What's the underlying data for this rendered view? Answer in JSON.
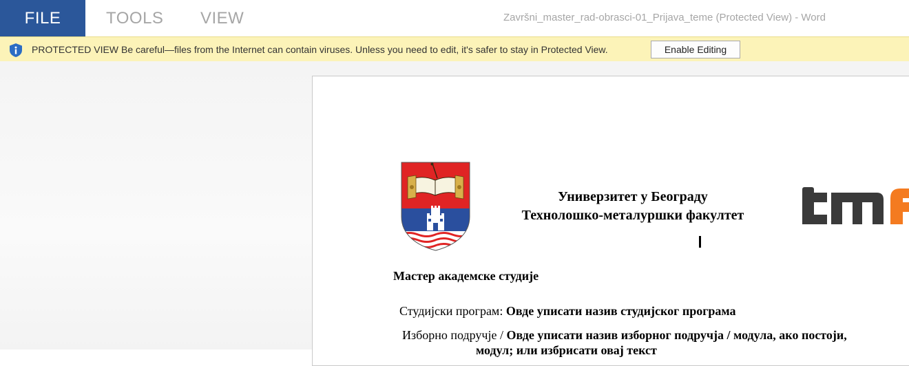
{
  "ribbon": {
    "tabs": [
      "FILE",
      "TOOLS",
      "VIEW"
    ],
    "window_title": "Završni_master_rad-obrasci-01_Prijava_teme (Protected View) - Word"
  },
  "protected_view": {
    "label": "PROTECTED VIEW",
    "message": "Be careful—files from the Internet can contain viruses. Unless you need to edit, it's safer to stay in Protected View.",
    "button": "Enable Editing",
    "icon": "shield-info-icon"
  },
  "document": {
    "university_line": "Универзитет у Београду",
    "faculty_line": "Технолошко-металуршки факултет",
    "study_type": "Мастер академске студије",
    "program_label": "Студијски програм: ",
    "program_value": "Овде уписати назив студијског програма",
    "area_label": "Изборно подручје / ",
    "area_value": "Овде уписати назив изборног подручја / модула, ако постоји,",
    "area_value_cont": "модул; или избрисати овај текст",
    "crest_book_text": "ВЕЛИКО ЗА ВЕЛИКО",
    "logo_text": "tmf"
  },
  "colors": {
    "file_tab": "#2b579a",
    "protected_bar": "#fcf3b8",
    "logo_dark": "#3a3a3a",
    "logo_orange": "#f47b20",
    "crest_red": "#e02424",
    "crest_blue": "#2a4f9e"
  }
}
